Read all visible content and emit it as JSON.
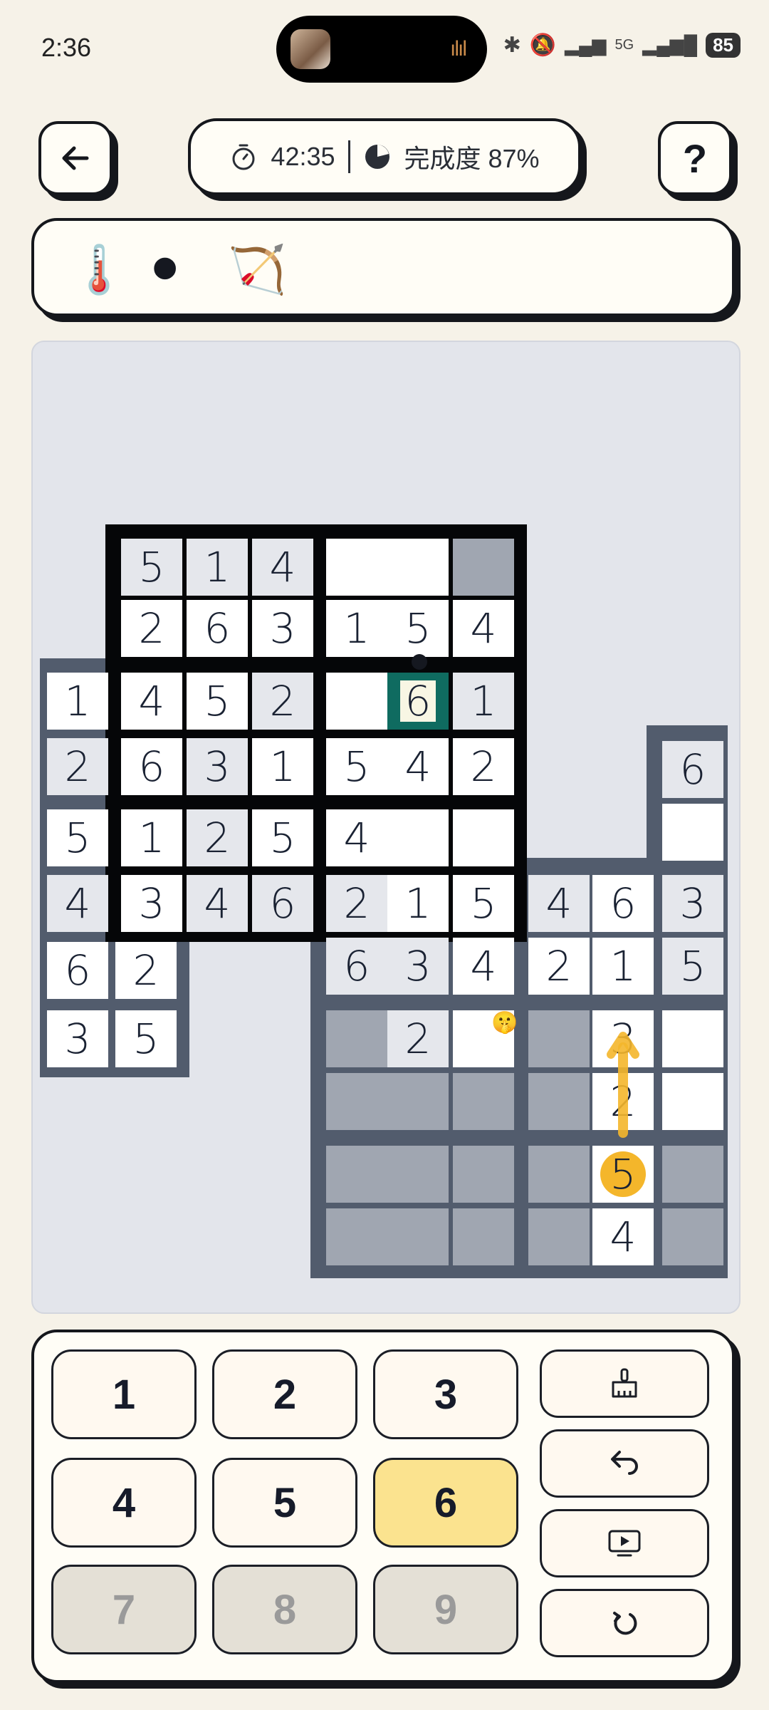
{
  "status": {
    "time": "2:36",
    "battery": "85",
    "network": "5G"
  },
  "header": {
    "timer": "42:35",
    "progress": "完成度 87%",
    "help_label": "?"
  },
  "tools": [
    {
      "name": "thermometer-tool",
      "glyph": "🌡️"
    },
    {
      "name": "black-circle-tool",
      "glyph": "⚫"
    },
    {
      "name": "bow-arrow-tool",
      "glyph": "🏹"
    }
  ],
  "board": {
    "r0": [
      "5",
      "1",
      "4",
      "",
      "",
      ""
    ],
    "r1": [
      "2",
      "6",
      "3",
      "1",
      "5",
      "4"
    ],
    "r2": [
      "1",
      "4",
      "5",
      "2",
      "",
      "6",
      "1"
    ],
    "r3": [
      "2",
      "6",
      "3",
      "1",
      "5",
      "4",
      "2",
      "6"
    ],
    "r4": [
      "5",
      "1",
      "2",
      "5",
      "4"
    ],
    "r5": [
      "4",
      "3",
      "4",
      "6",
      "2",
      "1",
      "5",
      "4",
      "6",
      "3"
    ],
    "r6": [
      "6",
      "2",
      "6",
      "3",
      "4",
      "2",
      "1",
      "5"
    ],
    "r7": [
      "3",
      "5",
      "2",
      "3"
    ],
    "r8": [
      "2"
    ],
    "r9": [
      "5"
    ],
    "r10": [
      "4"
    ]
  },
  "keypad": {
    "numbers": [
      "1",
      "2",
      "3",
      "4",
      "5",
      "6",
      "7",
      "8",
      "9"
    ],
    "selected": "6",
    "disabled": [
      "7",
      "8",
      "9"
    ],
    "actions": [
      "erase-icon",
      "undo-icon",
      "video-hint-icon",
      "restart-icon"
    ]
  },
  "colors": {
    "background": "#f6f2e8",
    "selected_cell": "#0f6b60",
    "active_key": "#fbe38f",
    "arrow": "#f4b62b"
  }
}
